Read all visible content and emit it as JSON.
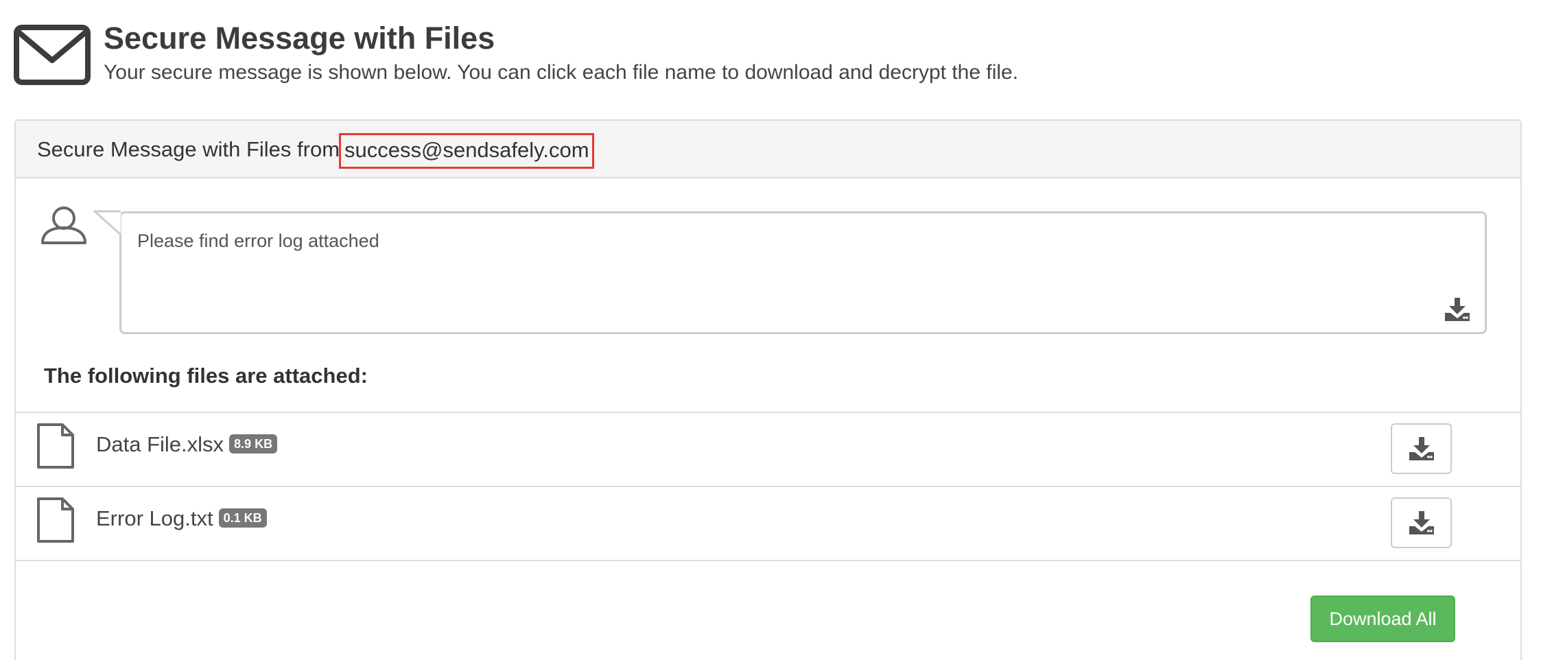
{
  "header": {
    "icon": "envelope-icon",
    "title": "Secure Message with Files",
    "subtitle": "Your secure message is shown below. You can click each file name to download and decrypt the file."
  },
  "panel": {
    "from_label": "Secure Message with Files from",
    "from_email": "success@sendsafely.com"
  },
  "message": {
    "avatar_icon": "user-icon",
    "text": "Please find error log attached",
    "download_icon": "download-icon"
  },
  "files": {
    "heading": "The following files are attached:",
    "items": [
      {
        "name": "Data File.xlsx",
        "size": "8.9 KB",
        "icon": "file-icon",
        "action_icon": "download-icon"
      },
      {
        "name": "Error Log.txt",
        "size": "0.1 KB",
        "icon": "file-icon",
        "action_icon": "download-icon"
      }
    ]
  },
  "actions": {
    "download_all_label": "Download All"
  },
  "colors": {
    "highlight_border": "#e53935",
    "success_button": "#5cb85c",
    "badge": "#777777"
  }
}
